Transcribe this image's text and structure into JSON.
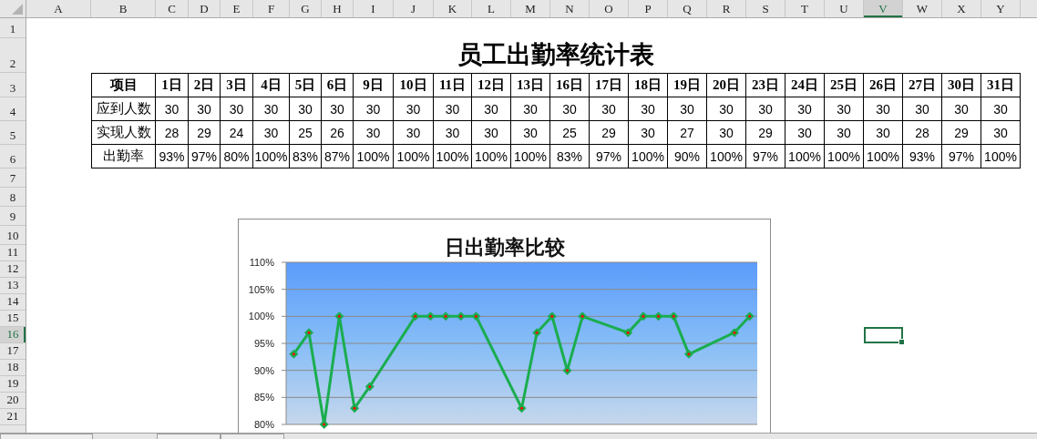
{
  "columns": [
    {
      "label": "A",
      "selected": false
    },
    {
      "label": "B",
      "selected": false
    },
    {
      "label": "C",
      "selected": false
    },
    {
      "label": "D",
      "selected": false
    },
    {
      "label": "E",
      "selected": false
    },
    {
      "label": "F",
      "selected": false
    },
    {
      "label": "G",
      "selected": false
    },
    {
      "label": "H",
      "selected": false
    },
    {
      "label": "I",
      "selected": false
    },
    {
      "label": "J",
      "selected": false
    },
    {
      "label": "K",
      "selected": false
    },
    {
      "label": "L",
      "selected": false
    },
    {
      "label": "M",
      "selected": false
    },
    {
      "label": "N",
      "selected": false
    },
    {
      "label": "O",
      "selected": false
    },
    {
      "label": "P",
      "selected": false
    },
    {
      "label": "Q",
      "selected": false
    },
    {
      "label": "R",
      "selected": false
    },
    {
      "label": "S",
      "selected": false
    },
    {
      "label": "T",
      "selected": false
    },
    {
      "label": "U",
      "selected": false
    },
    {
      "label": "V",
      "selected": true
    },
    {
      "label": "W",
      "selected": false
    },
    {
      "label": "X",
      "selected": false
    },
    {
      "label": "Y",
      "selected": false
    }
  ],
  "rows": [
    {
      "label": "1",
      "selected": false
    },
    {
      "label": "2",
      "selected": false
    },
    {
      "label": "3",
      "selected": false
    },
    {
      "label": "4",
      "selected": false
    },
    {
      "label": "5",
      "selected": false
    },
    {
      "label": "6",
      "selected": false
    },
    {
      "label": "7",
      "selected": false
    },
    {
      "label": "8",
      "selected": false
    },
    {
      "label": "9",
      "selected": false
    },
    {
      "label": "10",
      "selected": false
    },
    {
      "label": "11",
      "selected": false
    },
    {
      "label": "12",
      "selected": false
    },
    {
      "label": "13",
      "selected": false
    },
    {
      "label": "14",
      "selected": false
    },
    {
      "label": "15",
      "selected": false
    },
    {
      "label": "16",
      "selected": true
    },
    {
      "label": "17",
      "selected": false
    },
    {
      "label": "18",
      "selected": false
    },
    {
      "label": "19",
      "selected": false
    },
    {
      "label": "20",
      "selected": false
    },
    {
      "label": "21",
      "selected": false
    }
  ],
  "sheet": {
    "title": "员工出勤率统计表",
    "table": {
      "header": [
        "项目",
        "1日",
        "2日",
        "3日",
        "4日",
        "5日",
        "6日",
        "9日",
        "10日",
        "11日",
        "12日",
        "13日",
        "16日",
        "17日",
        "18日",
        "19日",
        "20日",
        "23日",
        "24日",
        "25日",
        "26日",
        "27日",
        "30日",
        "31日"
      ],
      "rows": [
        [
          "应到人数",
          "30",
          "30",
          "30",
          "30",
          "30",
          "30",
          "30",
          "30",
          "30",
          "30",
          "30",
          "30",
          "30",
          "30",
          "30",
          "30",
          "30",
          "30",
          "30",
          "30",
          "30",
          "30",
          "30"
        ],
        [
          "实现人数",
          "28",
          "29",
          "24",
          "30",
          "25",
          "26",
          "30",
          "30",
          "30",
          "30",
          "30",
          "25",
          "29",
          "30",
          "27",
          "30",
          "29",
          "30",
          "30",
          "30",
          "28",
          "29",
          "30"
        ],
        [
          "出勤率",
          "93%",
          "97%",
          "80%",
          "100%",
          "83%",
          "87%",
          "100%",
          "100%",
          "100%",
          "100%",
          "100%",
          "83%",
          "97%",
          "100%",
          "90%",
          "100%",
          "97%",
          "100%",
          "100%",
          "100%",
          "93%",
          "97%",
          "100%"
        ]
      ]
    }
  },
  "chart": {
    "chart_data": {
      "type": "line",
      "title": "日出勤率比较",
      "categories": [
        null,
        null,
        null,
        null,
        null,
        null,
        null,
        null,
        null,
        null,
        null,
        null,
        null,
        null,
        null,
        null,
        null,
        null,
        null,
        null,
        null,
        null,
        null,
        null,
        null,
        null,
        null,
        null,
        null,
        null,
        null
      ],
      "series": [
        {
          "color": "#1aad4f",
          "marker": "diamond",
          "values": [
            0.93,
            0.97,
            0.8,
            1,
            0.83,
            0.87,
            null,
            null,
            1,
            1,
            1,
            1,
            1,
            null,
            null,
            0.83,
            0.97,
            1,
            0.9,
            1,
            null,
            null,
            0.97,
            1,
            1,
            1,
            0.93,
            null,
            null,
            0.97,
            1
          ]
        }
      ],
      "grid": true,
      "ylim": [
        0.8,
        1.1
      ],
      "yticks": [
        {
          "value": 0.8,
          "label": "80%"
        },
        {
          "value": 0.85,
          "label": "85%"
        },
        {
          "value": 0.9,
          "label": "90%"
        },
        {
          "value": 0.95,
          "label": "95%"
        },
        {
          "value": 1,
          "label": "100%"
        },
        {
          "value": 1.05,
          "label": "105%"
        },
        {
          "value": 1.1,
          "label": "110%"
        }
      ]
    }
  }
}
